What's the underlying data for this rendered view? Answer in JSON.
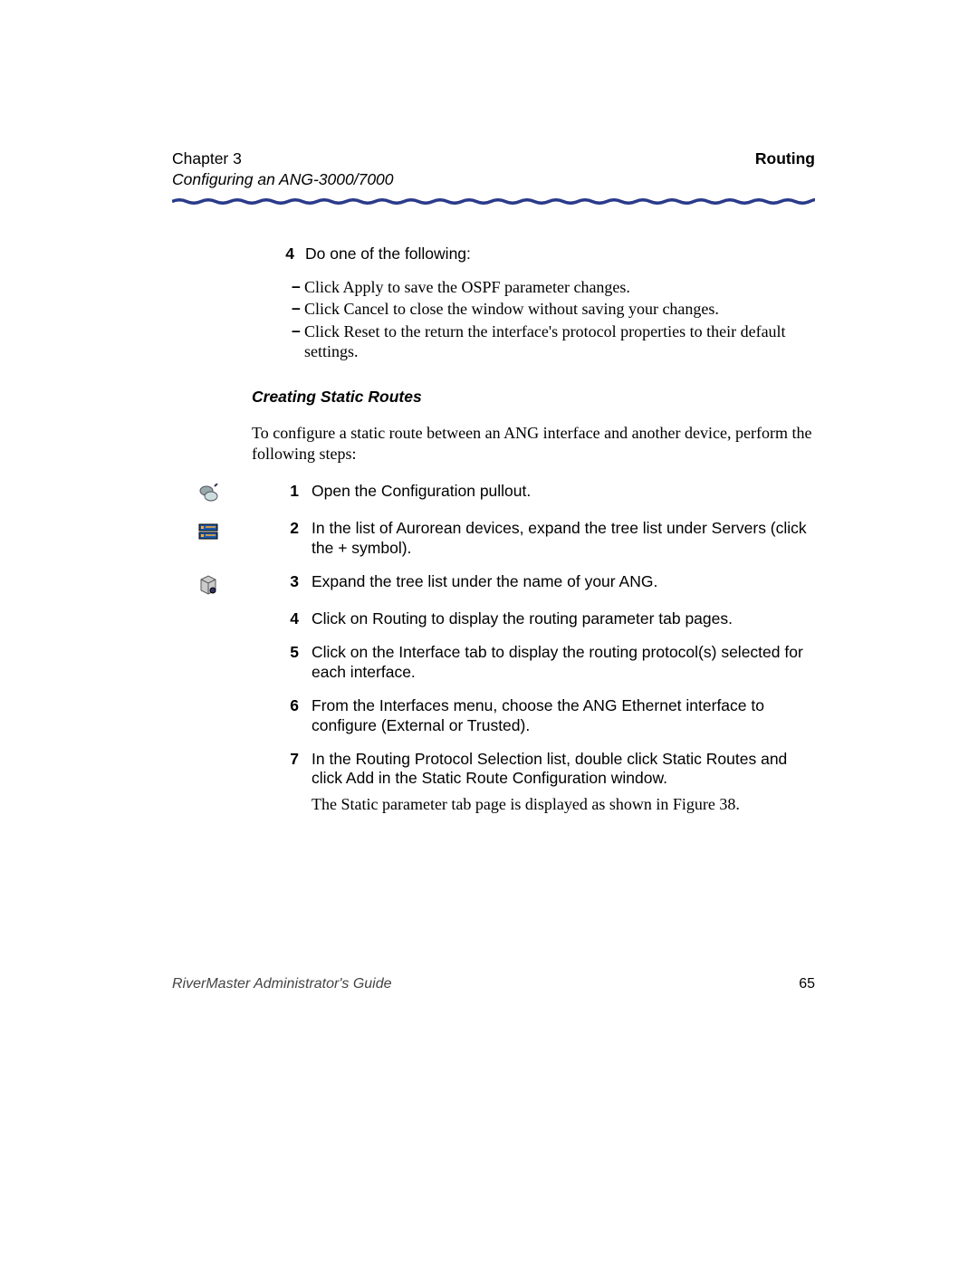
{
  "header": {
    "chapter": "Chapter 3",
    "subtitle": "Configuring an ANG-3000/7000",
    "section": "Routing"
  },
  "step4": {
    "num": "4",
    "lead": "Do one of the following:",
    "bullets": [
      "Click Apply to save the OSPF parameter changes.",
      "Click Cancel to close the window without saving your changes.",
      "Click Reset to the return the interface's protocol properties to their default settings."
    ]
  },
  "heading": "Creating Static Routes",
  "intro": "To configure a static route between an ANG interface and another device, perform the following steps:",
  "steps": [
    {
      "num": "1",
      "text": "Open the Configuration pullout.",
      "icon": "settings-icon"
    },
    {
      "num": "2",
      "text": "In the list of Aurorean devices, expand the tree list under Servers (click the + symbol).",
      "icon": "servers-icon"
    },
    {
      "num": "3",
      "text": "Expand the tree list under the name of your ANG.",
      "icon": "device-icon"
    },
    {
      "num": "4",
      "text": "Click on Routing to display the routing parameter tab pages.",
      "icon": ""
    },
    {
      "num": "5",
      "text": "Click on the Interface tab to display the routing protocol(s) selected for each interface.",
      "icon": ""
    },
    {
      "num": "6",
      "text": "From the Interfaces menu, choose the ANG Ethernet interface to configure (External or Trusted).",
      "icon": ""
    },
    {
      "num": "7",
      "text": "In the Routing Protocol Selection list, double click Static Routes and click Add in the Static Route Configuration window.",
      "icon": "",
      "follow": "The Static parameter tab page is displayed as shown in Figure 38."
    }
  ],
  "footer": {
    "guide": "RiverMaster Administrator's Guide",
    "page": "65"
  }
}
